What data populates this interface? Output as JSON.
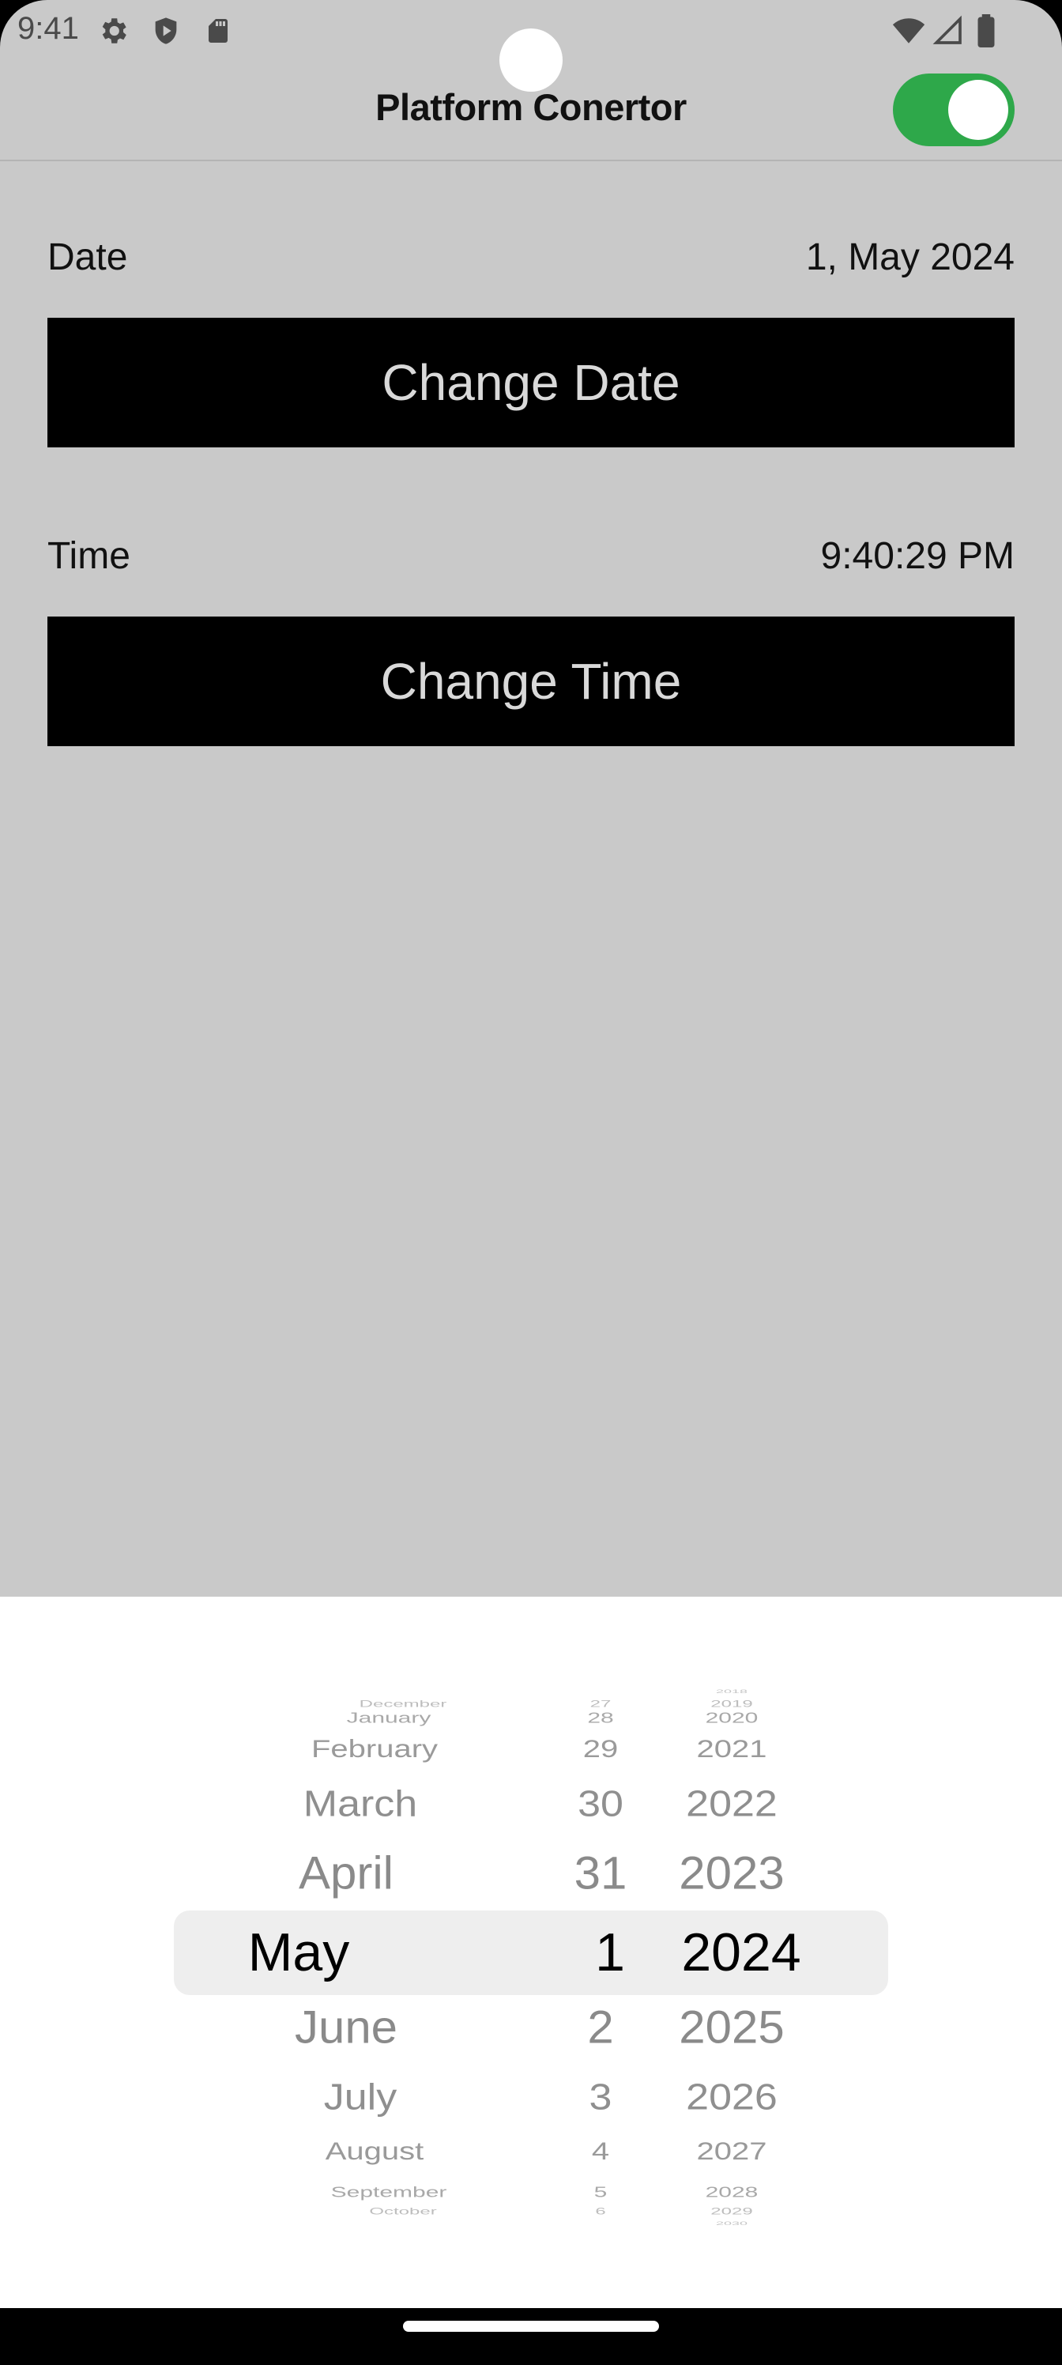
{
  "status_bar": {
    "time": "9:41"
  },
  "app_bar": {
    "title": "Platform Conertor",
    "toggle_on": true,
    "toggle_color": "#2ea84a"
  },
  "date_section": {
    "label": "Date",
    "value": "1, May 2024",
    "button_label": "Change Date"
  },
  "time_section": {
    "label": "Time",
    "value": "9:40:29 PM",
    "button_label": "Change Time"
  },
  "picker": {
    "months": [
      "December",
      "January",
      "February",
      "March",
      "April",
      "May",
      "June",
      "July",
      "August",
      "September",
      "October"
    ],
    "days": [
      "27",
      "28",
      "29",
      "30",
      "31",
      "1",
      "2",
      "3",
      "4",
      "5",
      "6"
    ],
    "years": [
      "2018",
      "2019",
      "2020",
      "2021",
      "2022",
      "2023",
      "2024",
      "2025",
      "2026",
      "2027",
      "2028",
      "2029",
      "2030"
    ],
    "selected": {
      "month": "May",
      "day": "1",
      "year": "2024"
    }
  }
}
